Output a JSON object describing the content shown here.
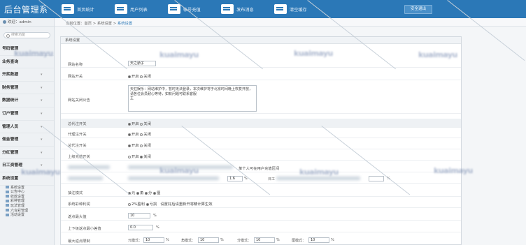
{
  "header": {
    "logo": "后台管理系",
    "nav": [
      "首页统计",
      "用户列表",
      "帐号充值",
      "发布消息",
      "清空缓存"
    ],
    "logout": "安全退出"
  },
  "sidebar": {
    "welcome": "欢迎：admin",
    "search_placeholder": "搜索功能",
    "menu": [
      {
        "label": "号码管理"
      },
      {
        "label": "业务查询"
      },
      {
        "label": "开奖数据"
      },
      {
        "label": "财务管理"
      },
      {
        "label": "数据统计"
      },
      {
        "label": "订户管理"
      },
      {
        "label": "管理人员"
      },
      {
        "label": "佣金管理"
      },
      {
        "label": "分红管理"
      },
      {
        "label": "日工资管理"
      },
      {
        "label": "系统设置"
      }
    ],
    "submenu": [
      "系统设置",
      "公告中心",
      "收款设置",
      "彩种管理",
      "玩法管理",
      "六合彩管理",
      "活动设置"
    ]
  },
  "breadcrumb": {
    "items": [
      "当前位置：首页",
      "系统设置",
      "系统设置"
    ]
  },
  "panel": {
    "title": "系统设置",
    "rows": {
      "name_label": "网站名称",
      "name_value": "天之骄子",
      "switch_label": "网站开关",
      "open": "开启",
      "close": "关闭",
      "notice_label": "网站关闭公告",
      "notice_value": "天狂娱乐：网站维护中，暂时无法登录，本次维护将于北京时间晚上恢复开放，请各位会员耐心等待，如有问题可联系客服",
      "notice_extra": "主",
      "total_switch": "总代注开关",
      "agent_switch": "代理注开关",
      "sub_agent_switch": "总代注开关",
      "upper_switch": "上级充值开关",
      "per_person": "单个人可在用户充值区间",
      "value1": "1.6",
      "pct": "%",
      "value2_label": "日工",
      "bonus_label": "抽注模式",
      "bonus_opts": [
        "元",
        "角",
        "分",
        "厘"
      ],
      "bonus_method": "系统彩种利润",
      "bonus_m1": "2%盈利",
      "bonus_m2": "亏损",
      "bonus_note": "设置好后请重新开将精计算生效",
      "max_label": "返点最大值",
      "max_value": "10",
      "min_label": "上下级返点最小差值",
      "min_value": "0.0",
      "last_label": "最大返点限制",
      "last_opts": [
        "元模式：",
        "角模式：",
        "分模式：",
        "厘模式："
      ],
      "last_values": [
        "10",
        "10",
        "10",
        "10"
      ]
    }
  },
  "watermark": "kuaimayu"
}
